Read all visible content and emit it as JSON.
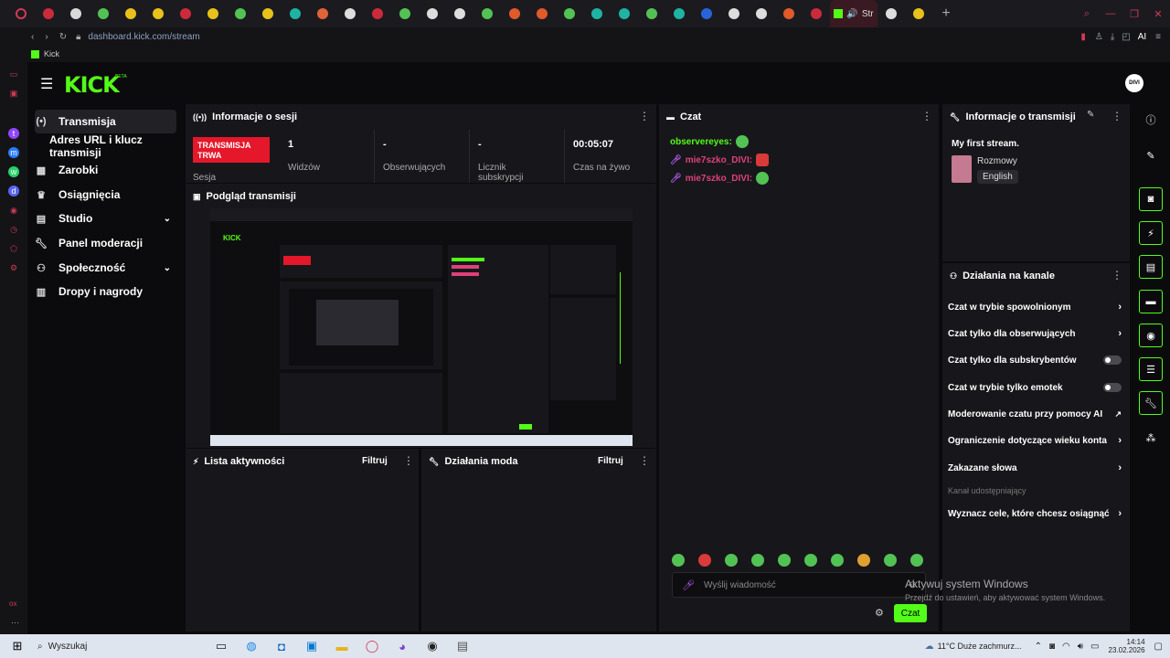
{
  "browser": {
    "url": "dashboard.kick.com/stream",
    "active_tab": "Str",
    "bookmark": "Kick",
    "ai_label": "AI",
    "tab_colors": [
      "#cc2a3b",
      "#d9d9d9",
      "#53c254",
      "#e8c21a",
      "#e8c21a",
      "#cc2a3b",
      "#e8c21a",
      "#53c254",
      "#e8c21a",
      "#1fb3a3",
      "#e0633a",
      "#ddd",
      "#cc2a3b",
      "#53c254",
      "#ddd",
      "#ddd",
      "#53c254",
      "#e05a2a",
      "#e05a2a",
      "#53c254",
      "#1fb3a3",
      "#1fb3a3",
      "#53c254",
      "#1fb3a3",
      "#2a63d9",
      "#ddd",
      "#ddd",
      "#e05a2a",
      "#cc2a3b",
      "#ddd",
      "#e8c21a"
    ]
  },
  "header": {
    "logo": "KICK",
    "beta": "BETA",
    "avatar": "DIVI"
  },
  "sidebar": {
    "items": [
      {
        "label": "Transmisja",
        "icon": "broadcast-icon"
      },
      {
        "label": "Adres URL i klucz transmisji",
        "icon": ""
      },
      {
        "label": "Zarobki",
        "icon": "chart-icon"
      },
      {
        "label": "Osiągnięcia",
        "icon": "trophy-icon"
      },
      {
        "label": "Studio",
        "icon": "studio-icon"
      },
      {
        "label": "Panel moderacji",
        "icon": "wrench-icon"
      },
      {
        "label": "Społeczność",
        "icon": "people-icon"
      },
      {
        "label": "Dropy i nagrody",
        "icon": "gift-icon"
      }
    ]
  },
  "session": {
    "title": "Informacje o sesji",
    "badge": "TRANSMISJA TRWA",
    "session_label": "Sesja",
    "stats": [
      {
        "value": "1",
        "label": "Widzów"
      },
      {
        "value": "-",
        "label": "Obserwujących"
      },
      {
        "value": "-",
        "label": "Licznik subskrypcji"
      },
      {
        "value": "00:05:07",
        "label": "Czas na żywo"
      }
    ]
  },
  "preview": {
    "title": "Podgląd transmisji"
  },
  "activity": {
    "title": "Lista aktywności",
    "filter": "Filtruj"
  },
  "modactions": {
    "title": "Działania moda",
    "filter": "Filtruj"
  },
  "chat": {
    "title": "Czat",
    "messages": [
      {
        "user": "observereyes:",
        "color": "#53fc18",
        "emoji_color": "#53c254"
      },
      {
        "user": "mie7szko_DIVI:",
        "color": "#e0407a",
        "emoji_color": "#d93a3a"
      },
      {
        "user": "mie7szko_DIVI:",
        "color": "#e0407a",
        "emoji_color": "#53c254"
      }
    ],
    "emotes": [
      "#53c254",
      "#d93a3a",
      "#53c254",
      "#53c254",
      "#53c254",
      "#53c254",
      "#53c254",
      "#e0a030",
      "#53c254",
      "#53c254"
    ],
    "input_placeholder": "Wyślij wiadomość",
    "send": "Czat"
  },
  "stream_info": {
    "title": "Informacje o transmisji",
    "stream_title": "My first stream.",
    "category": "Rozmowy",
    "language": "English"
  },
  "channel_actions": {
    "title": "Działania na kanale",
    "items": [
      {
        "label": "Czat w trybie spowolnionym",
        "control": "chevron"
      },
      {
        "label": "Czat tylko dla obserwujących",
        "control": "chevron"
      },
      {
        "label": "Czat tylko dla subskrybentów",
        "control": "toggle"
      },
      {
        "label": "Czat w trybie tylko emotek",
        "control": "toggle"
      },
      {
        "label": "Moderowanie czatu przy pomocy AI",
        "control": "external"
      },
      {
        "label": "Ograniczenie dotyczące wieku konta",
        "control": "chevron"
      },
      {
        "label": "Zakazane słowa",
        "control": "chevron"
      }
    ],
    "shared_label": "Kanał udostępniający",
    "goals": "Wyznacz cele, które chcesz osiągnąć"
  },
  "windows_watermark": {
    "line1": "Aktywuj system Windows",
    "line2": "Przejdź do ustawień, aby aktywować system Windows."
  },
  "taskbar": {
    "search": "Wyszukaj",
    "weather": "11°C  Duże zachmurz...",
    "time": "14:14",
    "date": "23.02.2026"
  }
}
